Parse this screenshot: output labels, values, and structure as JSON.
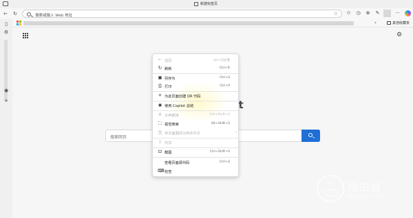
{
  "window": {
    "tab_title": "新建标签页"
  },
  "toolbar": {
    "address_placeholder": "搜索或输入 Web 地址"
  },
  "favorites_bar": {
    "folder_label": "其他收藏夹"
  },
  "page": {
    "search_placeholder": "搜索网页",
    "brand_fragment": "ft"
  },
  "context_menu": {
    "items": [
      {
        "label": "返回",
        "shortcut": "Alt+向左键",
        "icon": "back-arrow-icon",
        "disabled": true
      },
      {
        "label": "刷新",
        "shortcut": "Ctrl+R",
        "icon": "refresh-icon",
        "disabled": false
      },
      {
        "label": "另存为",
        "shortcut": "Ctrl+S",
        "icon": "save-as-icon",
        "disabled": false
      },
      {
        "label": "打印",
        "shortcut": "Ctrl+P",
        "icon": "print-icon",
        "disabled": false
      },
      {
        "label": "为此页面创建 QR 代码",
        "shortcut": "",
        "icon": "qr-code-icon",
        "disabled": false
      },
      {
        "label": "使用 Copilot 总结",
        "shortcut": "",
        "icon": "copilot-icon",
        "disabled": false
      },
      {
        "label": "大声朗读",
        "shortcut": "Ctrl+Shift+U",
        "icon": "read-aloud-icon",
        "disabled": true
      },
      {
        "label": "视觉搜索",
        "shortcut": "Alt+Shift+S",
        "icon": "visual-search-icon",
        "disabled": false
      },
      {
        "label": "将页面翻译为简体中文",
        "shortcut": "",
        "icon": "translate-icon",
        "disabled": true,
        "submenu": true
      },
      {
        "label": "共享",
        "shortcut": "",
        "icon": "share-icon",
        "disabled": true
      },
      {
        "label": "截图",
        "shortcut": "Ctrl+Shift+S",
        "icon": "screenshot-icon",
        "disabled": false
      },
      {
        "label": "查看页面源代码",
        "shortcut": "Ctrl+U",
        "icon": "",
        "disabled": false
      },
      {
        "label": "检查",
        "shortcut": "",
        "icon": "inspect-icon",
        "disabled": false
      }
    ]
  },
  "watermark": {
    "brand": "路由器",
    "domain": "luyouqi.com"
  }
}
